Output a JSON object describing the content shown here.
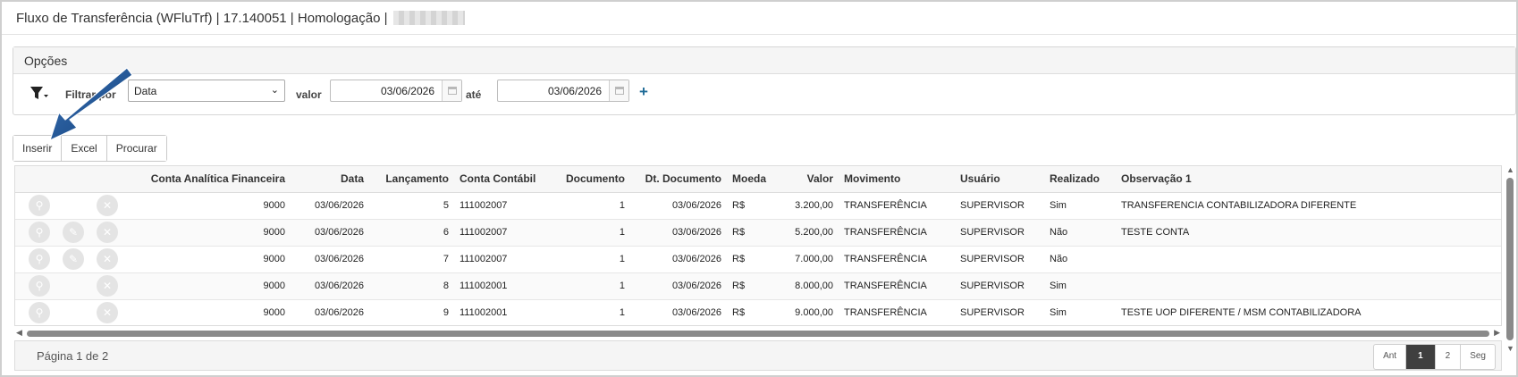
{
  "window": {
    "title": "Fluxo de Transferência (WFluTrf) | 17.140051 | Homologação |"
  },
  "options": {
    "header": "Opções",
    "filter_label": "Filtrar por",
    "filter_select_value": "Data",
    "valor_label": "valor",
    "ate_label": "até",
    "date_from": "03/06/2026",
    "date_to": "03/06/2026",
    "plus_label": "+"
  },
  "toolbar": {
    "insert_label": "Inserir",
    "excel_label": "Excel",
    "search_label": "Procurar"
  },
  "table": {
    "columns": [
      "Conta Analítica Financeira",
      "Data",
      "Lançamento",
      "Conta Contábil",
      "Documento",
      "Dt. Documento",
      "Moeda",
      "Valor",
      "Movimento",
      "Usuário",
      "Realizado",
      "Observação 1"
    ],
    "rows": [
      {
        "conta_analitica": "9000",
        "data": "03/06/2026",
        "lancamento": "5",
        "conta_contabil": "111002007",
        "documento": "1",
        "dt_documento": "03/06/2026",
        "moeda": "R$",
        "valor": "3.200,00",
        "movimento": "TRANSFERÊNCIA",
        "usuario": "SUPERVISOR",
        "realizado": "Sim",
        "observacao": "TRANSFERENCIA CONTABILIZADORA DIFERENTE",
        "editable": false
      },
      {
        "conta_analitica": "9000",
        "data": "03/06/2026",
        "lancamento": "6",
        "conta_contabil": "111002007",
        "documento": "1",
        "dt_documento": "03/06/2026",
        "moeda": "R$",
        "valor": "5.200,00",
        "movimento": "TRANSFERÊNCIA",
        "usuario": "SUPERVISOR",
        "realizado": "Não",
        "observacao": "TESTE CONTA",
        "editable": true
      },
      {
        "conta_analitica": "9000",
        "data": "03/06/2026",
        "lancamento": "7",
        "conta_contabil": "111002007",
        "documento": "1",
        "dt_documento": "03/06/2026",
        "moeda": "R$",
        "valor": "7.000,00",
        "movimento": "TRANSFERÊNCIA",
        "usuario": "SUPERVISOR",
        "realizado": "Não",
        "observacao": "",
        "editable": true
      },
      {
        "conta_analitica": "9000",
        "data": "03/06/2026",
        "lancamento": "8",
        "conta_contabil": "111002001",
        "documento": "1",
        "dt_documento": "03/06/2026",
        "moeda": "R$",
        "valor": "8.000,00",
        "movimento": "TRANSFERÊNCIA",
        "usuario": "SUPERVISOR",
        "realizado": "Sim",
        "observacao": "",
        "editable": false
      },
      {
        "conta_analitica": "9000",
        "data": "03/06/2026",
        "lancamento": "9",
        "conta_contabil": "111002001",
        "documento": "1",
        "dt_documento": "03/06/2026",
        "moeda": "R$",
        "valor": "9.000,00",
        "movimento": "TRANSFERÊNCIA",
        "usuario": "SUPERVISOR",
        "realizado": "Sim",
        "observacao": "TESTE UOP DIFERENTE / MSM CONTABILIZADORA",
        "editable": false
      }
    ]
  },
  "pagination": {
    "info": "Página 1 de 2",
    "prev_label": "Ant",
    "pages": [
      "1",
      "2"
    ],
    "active_page": "1",
    "next_label": "Seg"
  },
  "icons": {
    "filter": "funnel-icon",
    "calendar": "calendar-icon",
    "view": "magnifier-icon",
    "edit": "pencil-icon",
    "delete": "x-icon",
    "annotation": "blue-arrow-icon"
  },
  "colors": {
    "accent": "#1d6a96",
    "annotation_arrow": "#1f4e8c",
    "active_page": "#3f3f3f"
  }
}
